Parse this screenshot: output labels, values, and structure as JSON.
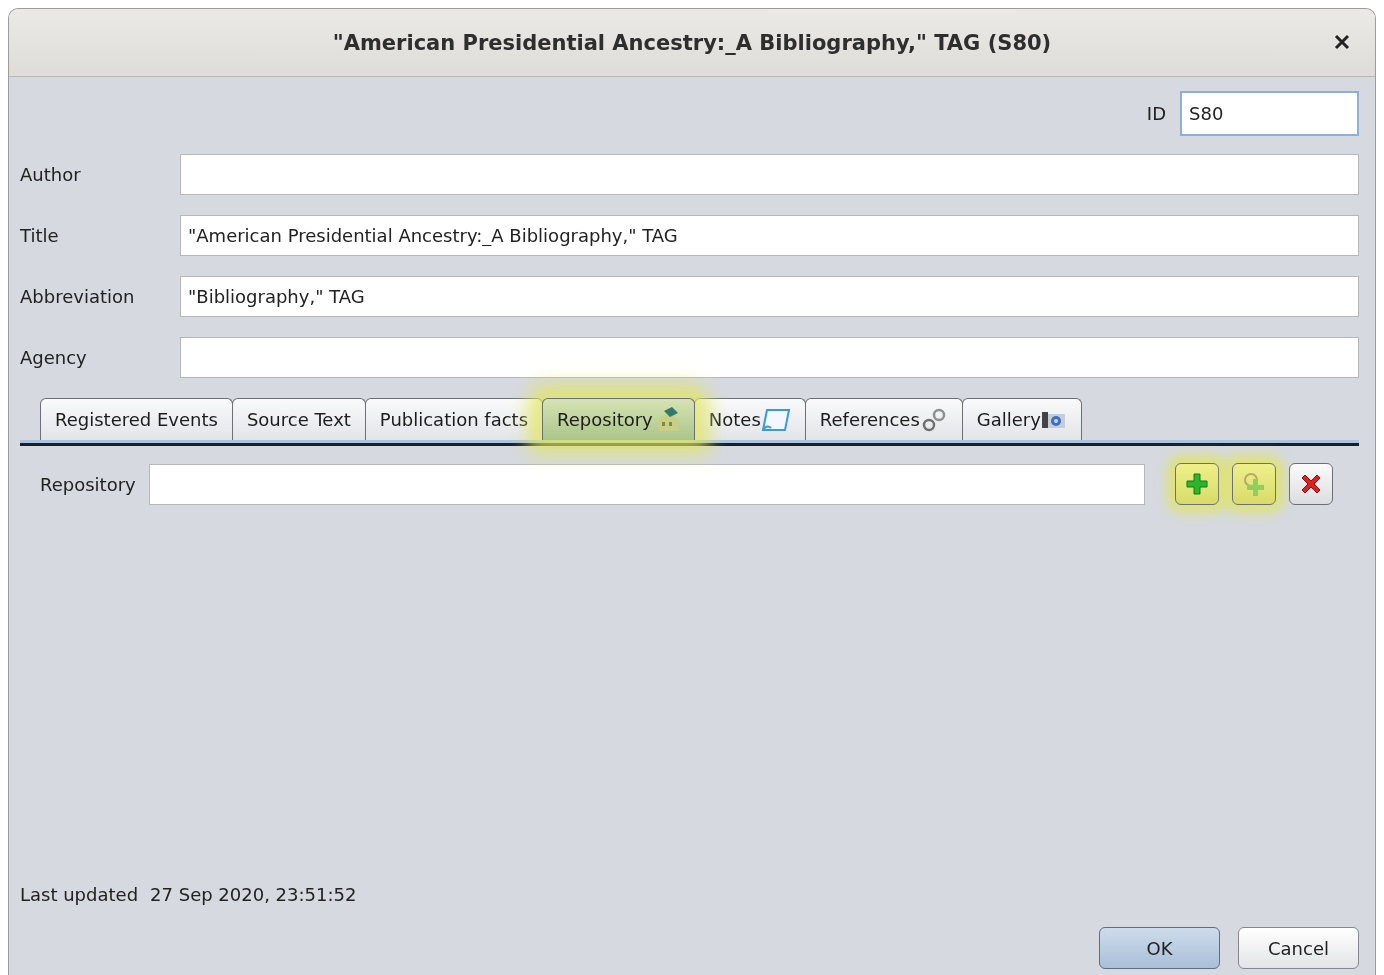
{
  "window": {
    "title": "\"American Presidential Ancestry:_A Bibliography,\" TAG (S80)"
  },
  "id_field": {
    "label": "ID",
    "value": "S80"
  },
  "fields": [
    {
      "label": "Author"
    },
    {
      "label": "Title",
      "value": "\"American Presidential Ancestry:_A Bibliography,\" TAG"
    },
    {
      "label": "Abbreviation",
      "value": "\"Bibliography,\" TAG"
    },
    {
      "label": "Agency"
    }
  ],
  "tabs": [
    {
      "label": "Registered Events",
      "kind": "plain",
      "selected": false,
      "highlighted": false
    },
    {
      "label": "Source Text",
      "kind": "plain",
      "selected": false,
      "highlighted": false
    },
    {
      "label": "Publication facts",
      "kind": "plain",
      "selected": false,
      "highlighted": false
    },
    {
      "label": "Repository",
      "kind": "repository",
      "selected": true,
      "highlighted": true
    },
    {
      "label": "Notes",
      "kind": "notes",
      "selected": false,
      "highlighted": false
    },
    {
      "label": "References",
      "kind": "references",
      "selected": false,
      "highlighted": false
    },
    {
      "label": "Gallery",
      "kind": "gallery",
      "selected": false,
      "highlighted": false
    }
  ],
  "repository": {
    "label": "Repository",
    "buttons": [
      {
        "kind": "add",
        "highlighted": true
      },
      {
        "kind": "link",
        "highlighted": true
      },
      {
        "kind": "remove",
        "highlighted": false
      }
    ]
  },
  "footer": {
    "label": "Last updated",
    "value": "27 Sep 2020, 23:51:52"
  },
  "buttons": [
    {
      "label": "OK",
      "default": true
    },
    {
      "label": "Cancel",
      "default": false
    }
  ]
}
